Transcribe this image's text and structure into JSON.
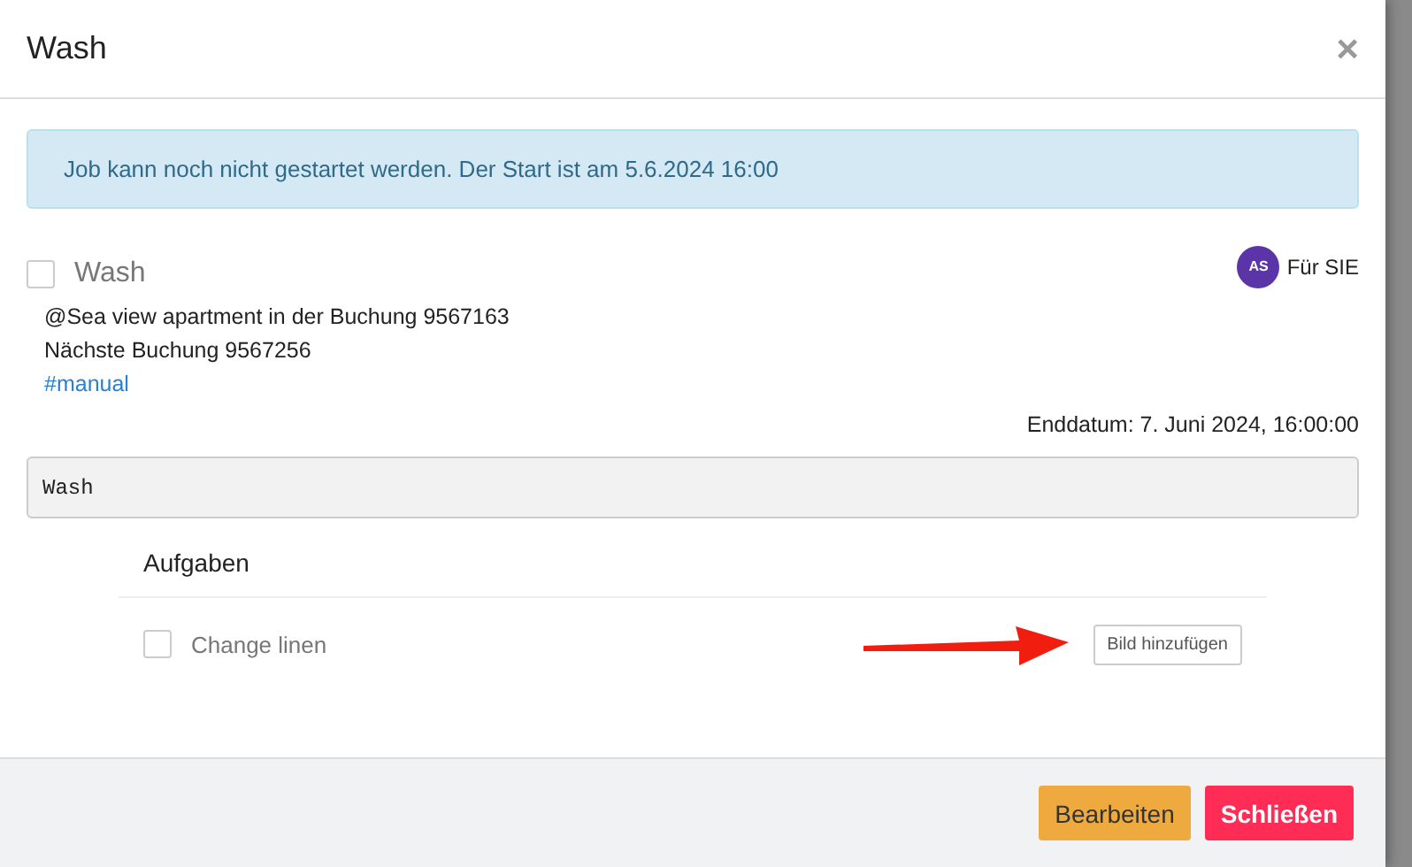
{
  "modal": {
    "title": "Wash",
    "close": "×"
  },
  "alert": "Job kann noch nicht gestartet werden. Der Start ist am 5.6.2024 16:00",
  "job": {
    "name": "Wash",
    "checked": false,
    "assignee": {
      "initials": "AS",
      "label": "Für SIE",
      "color": "#5b35a8"
    }
  },
  "details": [
    "@Sea view apartment in der Buchung 9567163",
    "Nächste Buchung 9567256"
  ],
  "tag": "#manual",
  "end_date": "Enddatum: 7. Juni 2024, 16:00:00",
  "description": "Wash",
  "tasks": {
    "heading": "Aufgaben",
    "items": [
      {
        "label": "Change linen",
        "checked": false,
        "button": "Bild hinzufügen"
      }
    ]
  },
  "footer": {
    "buttons": [
      {
        "label": "Bearbeiten",
        "kind": "edit"
      },
      {
        "label": "Schließen",
        "kind": "close"
      }
    ]
  }
}
